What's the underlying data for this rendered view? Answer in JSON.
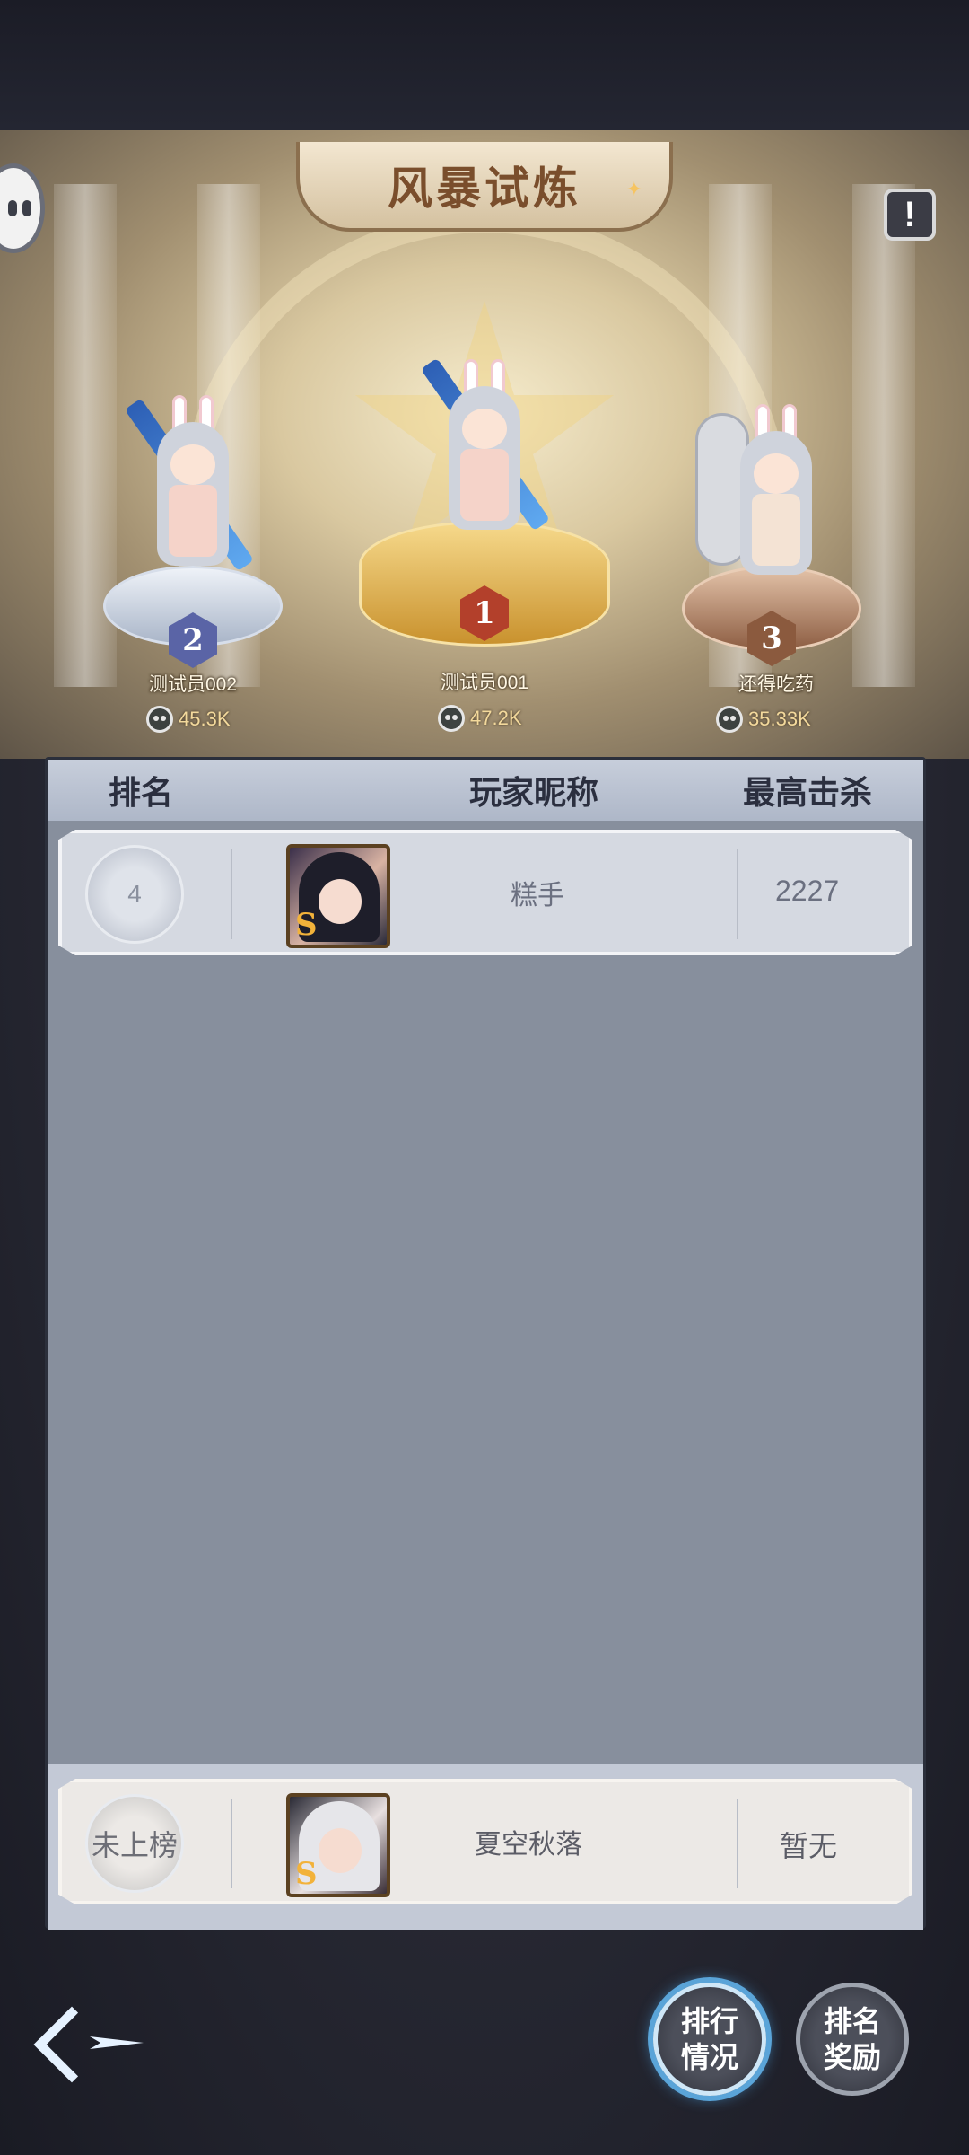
{
  "header": {
    "title": "风暴试炼"
  },
  "podium": [
    {
      "rank": "2",
      "name": "测试员002",
      "score": "45.3K"
    },
    {
      "rank": "1",
      "name": "测试员001",
      "score": "47.2K"
    },
    {
      "rank": "3",
      "name": "还得吃药",
      "score": "35.33K"
    }
  ],
  "table": {
    "headers": {
      "rank": "排名",
      "name": "玩家昵称",
      "kills": "最高击杀"
    },
    "rows": [
      {
        "rank": "4",
        "name": "糕手",
        "kills": "2227"
      }
    ],
    "self": {
      "rank": "未上榜",
      "name": "夏空秋落",
      "kills": "暂无"
    }
  },
  "buttons": {
    "ranking": "排行\n情况",
    "ranking_line1": "排行",
    "ranking_line2": "情况",
    "reward_line1": "排名",
    "reward_line2": "奖励"
  },
  "colors": {
    "board_bg": "#878f9d",
    "header_bg": "#c7cedb",
    "score_text": "#f3d99c",
    "gold_podium": "#e7b94a",
    "silver_podium": "#c9d3e3",
    "bronze_podium": "#b98a6f"
  }
}
